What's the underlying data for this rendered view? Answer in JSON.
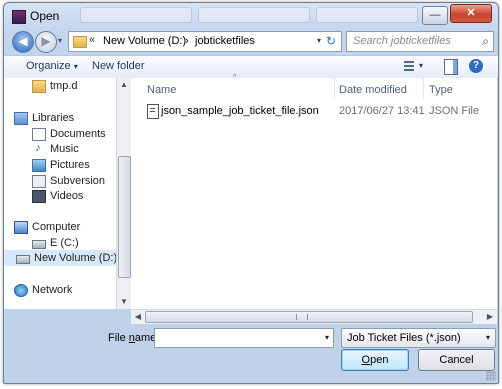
{
  "window": {
    "title": "Open",
    "close_glyph": "✕",
    "minimize_glyph": "—",
    "maximize_glyph": "☐"
  },
  "navigation": {
    "back_glyph": "◀",
    "forward_glyph": "▶",
    "history_caret": "▾",
    "crumb_prefix": "«",
    "breadcrumbs": [
      "New Volume (D:)",
      "jobticketfiles"
    ],
    "crumb_separator": "›",
    "address_dropdown": "▾",
    "refresh_glyph": "↻",
    "search_placeholder": "Search jobticketfiles",
    "search_glyph": "⌕"
  },
  "toolbar": {
    "organize_label": "Organize",
    "caret": "▾",
    "new_folder_label": "New folder",
    "help_glyph": "?"
  },
  "nav_pane": {
    "items": [
      {
        "label": "tmp.d",
        "icon": "folder-icon"
      },
      {
        "label": "Libraries",
        "icon": "libraries-icon"
      },
      {
        "label": "Documents",
        "icon": "documents-icon"
      },
      {
        "label": "Music",
        "icon": "music-icon"
      },
      {
        "label": "Pictures",
        "icon": "pictures-icon"
      },
      {
        "label": "Subversion",
        "icon": "subversion-icon"
      },
      {
        "label": "Videos",
        "icon": "videos-icon"
      },
      {
        "label": "Computer",
        "icon": "computer-icon"
      },
      {
        "label": "E (C:)",
        "icon": "drive-icon"
      },
      {
        "label": "New Volume (D:)",
        "icon": "drive-icon",
        "selected": true
      },
      {
        "label": "Network",
        "icon": "network-icon"
      }
    ]
  },
  "file_list": {
    "columns": [
      "Name",
      "Date modified",
      "Type"
    ],
    "sort_caret": "^",
    "rows": [
      {
        "name": "json_sample_job_ticket_file.json",
        "date_modified": "2017/06/27 13:41",
        "type": "JSON File"
      }
    ]
  },
  "scroll": {
    "up": "▲",
    "down": "▼",
    "left": "◀",
    "right": "▶",
    "grip": "≡"
  },
  "footer": {
    "file_name_label_pre": "File ",
    "file_name_label_ul": "n",
    "file_name_label_post": "ame:",
    "file_name_value": "",
    "file_name_dropdown": "▾",
    "file_type_value": "Job Ticket Files (*.json)",
    "file_type_dropdown": "▾",
    "open_label_ul": "O",
    "open_label_rest": "pen",
    "cancel_label": "Cancel"
  }
}
